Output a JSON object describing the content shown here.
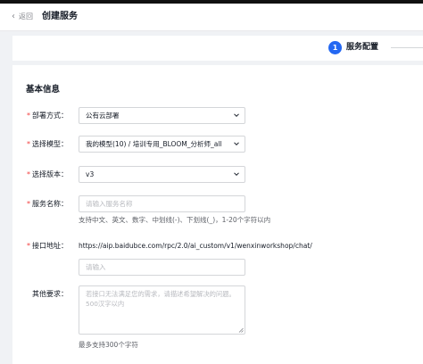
{
  "header": {
    "back_label": "返回",
    "title": "创建服务"
  },
  "steps": [
    {
      "number": "1",
      "label": "服务配置"
    }
  ],
  "form": {
    "section_title": "基本信息",
    "deploy": {
      "label": "部署方式：",
      "value": "公有云部署"
    },
    "model": {
      "label": "选择模型：",
      "value": "我的模型(10) / 培训专用_BLOOM_分析师_all"
    },
    "version": {
      "label": "选择版本：",
      "value": "v3"
    },
    "service_name": {
      "label": "服务名称：",
      "placeholder": "请输入服务名称",
      "hint": "支持中文、英文、数字、中划线(-)、下划线(_)，1-20个字符以内"
    },
    "endpoint": {
      "label": "接口地址：",
      "url": "https://aip.baidubce.com/rpc/2.0/ai_custom/v1/wenxinworkshop/chat/",
      "placeholder": "请输入"
    },
    "other": {
      "label": "其他要求：",
      "placeholder": "若接口无法满足您的需求，请描述希望解决的问题。500汉字以内",
      "hint": "最多支持300个字符"
    }
  },
  "colors": {
    "accent": "#2468f2",
    "required": "#f33e3e",
    "border": "#d4d6d9",
    "background": "#f0f2f5"
  }
}
